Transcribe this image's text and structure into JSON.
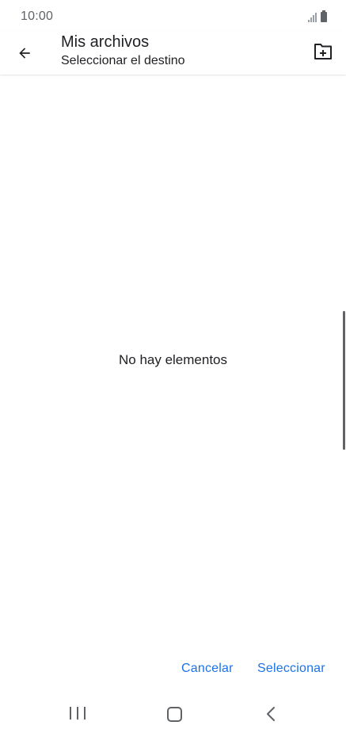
{
  "status_bar": {
    "time": "10:00",
    "icons": [
      "signal-icon",
      "battery-icon"
    ]
  },
  "app_bar": {
    "back_icon": "arrow-left-icon",
    "title": "Mis archivos",
    "subtitle": "Seleccionar el destino",
    "new_folder_icon": "create-new-folder-icon"
  },
  "content": {
    "empty_message": "No hay elementos"
  },
  "actions": {
    "cancel_label": "Cancelar",
    "select_label": "Seleccionar"
  },
  "navigation_bar": {
    "recent_icon": "recent-apps-icon",
    "home_icon": "home-icon",
    "back_icon": "back-chevron-icon"
  },
  "colors": {
    "accent": "#1a73e8",
    "text_primary": "#202124",
    "icon_gray": "#5f6368",
    "background": "#ffffff"
  }
}
